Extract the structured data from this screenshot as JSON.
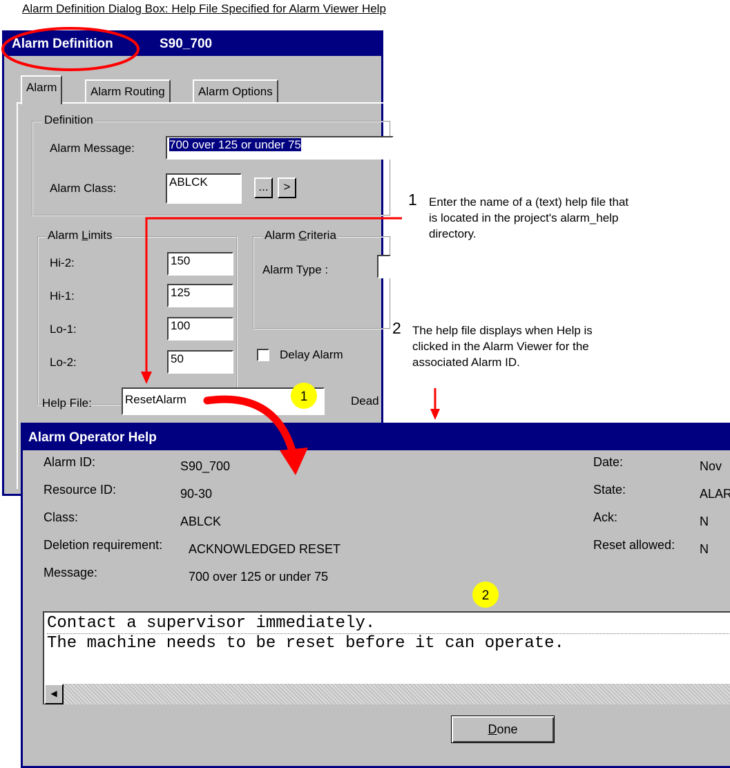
{
  "caption": "Alarm Definition Dialog Box: Help File Specified for Alarm Viewer Help",
  "alarm_definition": {
    "title": "Alarm Definition",
    "tag": "S90_700",
    "tabs": [
      {
        "label": "Alarm",
        "active": true
      },
      {
        "label": "Alarm Routing",
        "active": false
      },
      {
        "label": "Alarm Options",
        "active": false
      }
    ],
    "definition": {
      "group_label": "Definition",
      "alarm_message_label": "Alarm Message:",
      "alarm_message_value": "700 over 125 or under 75",
      "alarm_class_label": "Alarm Class:",
      "alarm_class_value": "ABLCK",
      "browse_label": "...",
      "next_label": ">"
    },
    "alarm_limits": {
      "group_label_prefix": "Alarm ",
      "group_label_accel": "L",
      "group_label_suffix": "imits",
      "items": [
        {
          "label": "Hi-2:",
          "value": "150"
        },
        {
          "label": "Hi-1:",
          "value": "125"
        },
        {
          "label": "Lo-1:",
          "value": "100"
        },
        {
          "label": "Lo-2:",
          "value": "50"
        }
      ]
    },
    "alarm_criteria": {
      "group_label_prefix": "Alarm ",
      "group_label_accel": "C",
      "group_label_suffix": "riteria",
      "alarm_type_label": "Alarm Type :"
    },
    "delay_alarm_label": "Delay Alarm",
    "help_file_label": "Help File:",
    "help_file_value": "ResetAlarm",
    "deadband_label": "Dead"
  },
  "annotations": {
    "step1": {
      "number": "1",
      "text_lines": [
        "Enter the name of a (text) help file that",
        "is located in the project's alarm_help",
        "directory."
      ]
    },
    "step2": {
      "number": "2",
      "text_lines": [
        "The help file displays when Help is",
        "clicked in the Alarm Viewer for the",
        "associated Alarm ID."
      ]
    },
    "badge1": "1",
    "badge2": "2",
    "colors": {
      "arrow": "#ff0000",
      "badge": "#ffff00",
      "title_bar": "#000080"
    }
  },
  "operator_help": {
    "title": "Alarm Operator Help",
    "left_fields": [
      {
        "label": "Alarm ID:",
        "value": "S90_700"
      },
      {
        "label": "Resource ID:",
        "value": "90-30"
      },
      {
        "label": "Class:",
        "value": "ABLCK"
      },
      {
        "label": "Deletion requirement:",
        "value": "ACKNOWLEDGED RESET"
      },
      {
        "label": "Message:",
        "value": "700 over 125 or under 75"
      }
    ],
    "right_fields": [
      {
        "label": "Date:",
        "value": "Nov"
      },
      {
        "label": "State:",
        "value": "ALAR"
      },
      {
        "label": "Ack:",
        "value": "N"
      },
      {
        "label": "Reset allowed:",
        "value": "N"
      }
    ],
    "help_text_line1": "Contact a supervisor immediately.",
    "help_text_line2": "The machine needs to be reset before it can operate.",
    "done_accel": "D",
    "done_rest": "one"
  }
}
